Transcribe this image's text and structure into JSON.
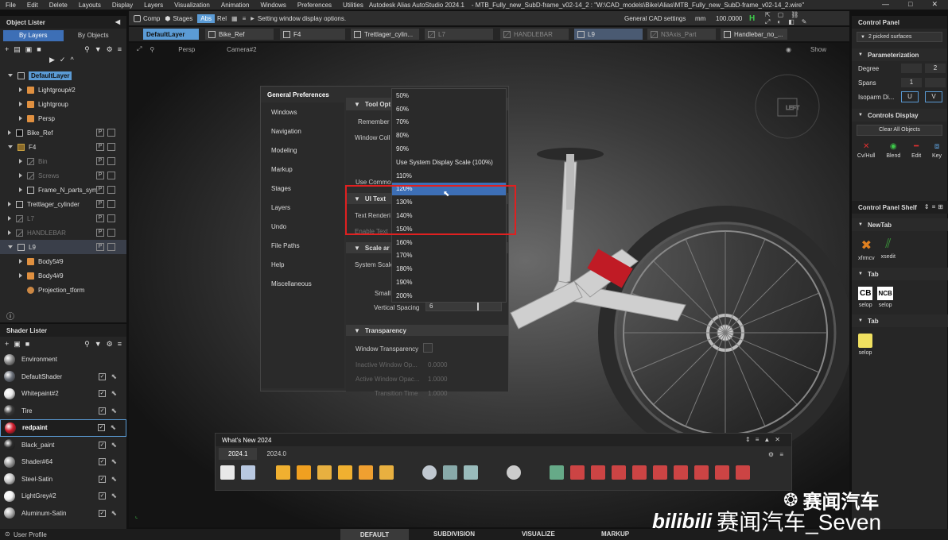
{
  "menubar": {
    "items": [
      "File",
      "Edit",
      "Delete",
      "Layouts",
      "Display",
      "Layers",
      "Visualization",
      "Animation",
      "Windows",
      "Preferences",
      "Utilities",
      "Autodesk Alias AutoStudio 2024.1"
    ],
    "window_title": "- MTB_Fully_new_SubD-frame_v02-14_2 : \"W:\\CAD_models\\Bike\\Alias\\MTB_Fully_new_SubD-frame_v02-14_2.wire\"",
    "controls": [
      "—",
      "□",
      "✕"
    ]
  },
  "object_lister": {
    "title": "Object Lister",
    "tabs": [
      "By Layers",
      "By Objects"
    ],
    "rows": [
      {
        "label": "DefaultLayer",
        "level": 0,
        "icon": "square",
        "expanded": true,
        "selected": true
      },
      {
        "label": "Lightgroup#2",
        "level": 1,
        "icon": "cube"
      },
      {
        "label": "Lightgroup",
        "level": 1,
        "icon": "cube"
      },
      {
        "label": "Persp",
        "level": 1,
        "icon": "cube"
      },
      {
        "label": "Bike_Ref",
        "level": 0,
        "icon": "square-black",
        "flags": true
      },
      {
        "label": "F4",
        "level": 0,
        "icon": "folder",
        "expanded": true,
        "flags": true
      },
      {
        "label": "Bin",
        "level": 1,
        "icon": "slash",
        "dim": true,
        "flags": true
      },
      {
        "label": "Screws",
        "level": 1,
        "icon": "slash",
        "dim": true,
        "flags": true
      },
      {
        "label": "Frame_N_parts_sym",
        "level": 1,
        "icon": "square",
        "flags": true
      },
      {
        "label": "Trettlager_cylinder",
        "level": 0,
        "icon": "square",
        "flags": true
      },
      {
        "label": "L7",
        "level": 0,
        "icon": "slash",
        "dim": true,
        "flags": true
      },
      {
        "label": "HANDLEBAR",
        "level": 0,
        "icon": "slash",
        "dim": true,
        "flags": true
      },
      {
        "label": "L9",
        "level": 0,
        "icon": "square",
        "expanded": true,
        "flags": true,
        "highlight": true
      },
      {
        "label": "Body5#9",
        "level": 1,
        "icon": "cube"
      },
      {
        "label": "Body4#9",
        "level": 1,
        "icon": "cube"
      },
      {
        "label": "Projection_tform",
        "level": 1,
        "icon": "proj"
      }
    ],
    "info_icon": "ⓘ"
  },
  "shader_lister": {
    "title": "Shader Lister",
    "rows": [
      {
        "label": "Environment",
        "color": "#8a8a8a"
      },
      {
        "label": "DefaultShader",
        "color": "#6a6f78"
      },
      {
        "label": "Whitepaint#2",
        "color": "#e8e8e8"
      },
      {
        "label": "Tire",
        "color": "#3a3a3a"
      },
      {
        "label": "redpaint",
        "color": "#d21c2c",
        "selected": true
      },
      {
        "label": "Black_paint",
        "color": "#2b2b2b"
      },
      {
        "label": "Shader#64",
        "color": "#9a9a9a"
      },
      {
        "label": "Steel-Satin",
        "color": "#c8c8c8"
      },
      {
        "label": "LightGrey#2",
        "color": "#f0f0f0"
      },
      {
        "label": "Aluminum-Satin",
        "color": "#b0b0b0"
      }
    ]
  },
  "top_toolbar": {
    "comp": "Comp",
    "stages": "Stages",
    "abs": "Abs",
    "rel": "Rel",
    "status": "Setting window display options.",
    "cad_settings": "General CAD settings",
    "units": "mm",
    "tolerance": "100.0000",
    "h_label": "H"
  },
  "layer_tabs": [
    "DefaultLayer",
    "Bike_Ref",
    "F4",
    "Trettlager_cylin...",
    "L7",
    "HANDLEBAR",
    "L9",
    "N3Axis_Part",
    "Handlebar_no_..."
  ],
  "viewport": {
    "view": "Persp",
    "camera": "Camera#2",
    "show": "Show"
  },
  "prefs": {
    "title": "General Preferences",
    "menu": [
      "Windows",
      "Navigation",
      "Modeling",
      "Markup",
      "Stages",
      "Layers",
      "Undo",
      "File Paths",
      "Help",
      "Miscellaneous"
    ],
    "sections": {
      "tool_options": "Tool Opt",
      "remember": "Remember",
      "window_colors": "Window Coll",
      "use_common": "Use Commor",
      "ui_text": "UI Text",
      "text_rendering": "Text Renderi",
      "enable_text": "Enable Text",
      "scale": "Scale ar",
      "system_scale": "System Scale",
      "small": "Small",
      "vertical_spacing": "Vertical Spacing",
      "vertical_spacing_val": "6",
      "transparency": "Transparency",
      "window_transparency": "Window Transparency",
      "inactive_opacity": "Inactive Window Op...",
      "inactive_val": "0.0000",
      "active_opacity": "Active Window Opac...",
      "active_val": "1.0000",
      "transition_time": "Transition Time",
      "transition_val": "1.0000"
    },
    "dropdown": [
      "50%",
      "60%",
      "70%",
      "80%",
      "90%",
      "Use System Display Scale (100%)",
      "110%",
      "120%",
      "130%",
      "140%",
      "150%",
      "160%",
      "170%",
      "180%",
      "190%",
      "200%"
    ],
    "dropdown_selected": "120%"
  },
  "whats_new": {
    "title": "What's New 2024",
    "tabs": [
      "2024.1",
      "2024.0"
    ]
  },
  "control_panel": {
    "title": "Control Panel",
    "selection": "2 picked surfaces",
    "param_title": "Parameterization",
    "degree_label": "Degree",
    "degree_val": "2",
    "spans_label": "Spans",
    "spans_val": "1",
    "isoparm_label": "Isoparm Di...",
    "u_label": "U",
    "v_label": "V",
    "controls_display": "Controls Display",
    "clear_all": "Clear All Objects",
    "cd_items": [
      "Cv/Hull",
      "Blend",
      "Edit",
      "Key"
    ]
  },
  "shelf": {
    "title": "Control Panel Shelf",
    "sections": [
      {
        "title": "NewTab",
        "items": [
          "xfrmcv",
          "xsedit"
        ]
      },
      {
        "title": "Tab",
        "items": [
          "selop",
          "selop"
        ]
      },
      {
        "title": "Tab",
        "items": [
          "selop"
        ]
      }
    ],
    "cb": "CB",
    "ncb": "NCB"
  },
  "bottom": {
    "user_profile": "User Profile",
    "tabs": [
      "DEFAULT",
      "SUBDIVISION",
      "VISUALIZE",
      "MARKUP"
    ]
  },
  "watermark": {
    "wechat": "赛闻汽车",
    "bili": "赛闻汽车_Seven",
    "bili_logo": "bilibili"
  },
  "colors": {
    "accent_blue": "#3d6fb6",
    "selection_blue": "#5b9bd5",
    "highlight_red": "#e02020"
  }
}
